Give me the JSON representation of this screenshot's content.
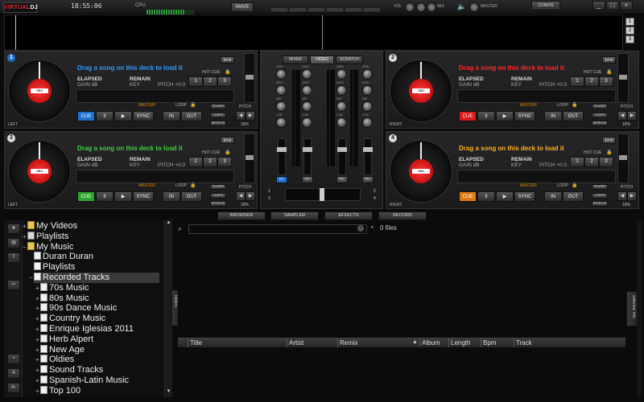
{
  "topbar": {
    "logo_v": "VIRTUAL",
    "logo_d": "DJ",
    "clock": "18:55:06",
    "cpu_label": "CPU",
    "wave_button": "WAVE",
    "vol_label": "VOL",
    "mix_label": "MIX",
    "master_label": "MASTER",
    "config_button": "CONFIG",
    "minimize": "_",
    "maximize": "□",
    "close": "×"
  },
  "layout_buttons": [
    "1",
    "2",
    "3"
  ],
  "decks": [
    {
      "number": "1",
      "side": "LEFT",
      "prompt": "Drag a song on this deck to load it",
      "prompt_color": "#2e9bff",
      "cue_color": "#1f6fd0",
      "active": true
    },
    {
      "number": "2",
      "side": "RIGHT",
      "prompt": "Drag a song on this deck to load it",
      "prompt_color": "#ff2a2a",
      "cue_color": "#d81a1a",
      "active": false
    },
    {
      "number": "3",
      "side": "LEFT",
      "prompt": "Drag a song on this deck to load it",
      "prompt_color": "#3fd13f",
      "cue_color": "#2fa52f",
      "active": false
    },
    {
      "number": "4",
      "side": "RIGHT",
      "prompt": "Drag a song on this deck to load it",
      "prompt_color": "#ffb21a",
      "cue_color": "#e07a10",
      "active": false
    }
  ],
  "deck_labels": {
    "elapsed": "ELAPSED",
    "remain": "REMAIN",
    "gain": "GAIN dB",
    "key": "KEY",
    "pitch": "PITCH +0.0",
    "bpm": "BPM",
    "hot_cue": "HOT CUE",
    "hot_cue_buttons": [
      "1",
      "2",
      "3"
    ],
    "master": "MASTER",
    "loop": "LOOP",
    "cue": "CUE",
    "pause": "II",
    "play": "▶",
    "sync": "SYNC",
    "in": "IN",
    "out": "OUT",
    "player": "PLAYER",
    "loops": "LOOPS",
    "effects": "EFFECTS",
    "pitch_label": "PITCH",
    "pitch_pct": "16%"
  },
  "mixer": {
    "tabs": [
      "MIXER",
      "VIDEO",
      "SCRATCH"
    ],
    "active_tab": "VIDEO",
    "knob_labels": [
      "GAIN",
      "HIGH",
      "MID",
      "LOW"
    ],
    "pfl": "PFL",
    "deck_nums_left": [
      "1",
      "3"
    ],
    "deck_nums_right": [
      "2",
      "4"
    ]
  },
  "bottom_tabs": [
    "BROWSER",
    "SAMPLER",
    "EFFECTS",
    "RECORD"
  ],
  "tree": [
    {
      "label": "My Videos",
      "icon": "folder",
      "indent": 0,
      "expander": "+"
    },
    {
      "label": "Playlists",
      "icon": "list",
      "indent": 0,
      "expander": "+"
    },
    {
      "label": "My Music",
      "icon": "folder",
      "indent": 0,
      "expander": "-"
    },
    {
      "label": "Duran Duran",
      "icon": "doc",
      "indent": 1,
      "expander": ""
    },
    {
      "label": "Playlists",
      "icon": "doc",
      "indent": 1,
      "expander": ""
    },
    {
      "label": "Recorded Tracks",
      "icon": "doc",
      "indent": 1,
      "expander": "-",
      "selected": true
    },
    {
      "label": "70s Music",
      "icon": "doc",
      "indent": 2,
      "expander": "+"
    },
    {
      "label": "80s Music",
      "icon": "doc",
      "indent": 2,
      "expander": "+"
    },
    {
      "label": "90s Dance Music",
      "icon": "doc",
      "indent": 2,
      "expander": "+"
    },
    {
      "label": "Country Music",
      "icon": "doc",
      "indent": 2,
      "expander": "+"
    },
    {
      "label": "Enrique Iglesias 2011",
      "icon": "doc",
      "indent": 2,
      "expander": "+"
    },
    {
      "label": "Herb Alpert",
      "icon": "doc",
      "indent": 2,
      "expander": "+"
    },
    {
      "label": "New Age",
      "icon": "doc",
      "indent": 2,
      "expander": "+"
    },
    {
      "label": "Oldies",
      "icon": "doc",
      "indent": 2,
      "expander": "+"
    },
    {
      "label": "Sound Tracks",
      "icon": "doc",
      "indent": 2,
      "expander": "+"
    },
    {
      "label": "Spanish-Latin Music",
      "icon": "doc",
      "indent": 2,
      "expander": "+"
    },
    {
      "label": "Top 100",
      "icon": "doc",
      "indent": 2,
      "expander": "+"
    }
  ],
  "browser": {
    "folders_tab": "folders",
    "sideview_tab": "sideview info",
    "search_value": "",
    "files_count": "0 files",
    "columns": [
      "Title",
      "Artist",
      "Remix",
      "Album",
      "Length",
      "Bpm",
      "Track"
    ]
  },
  "left_tools": [
    "★",
    "▤",
    "T",
    "↩",
    "•",
    "A",
    "A-"
  ]
}
